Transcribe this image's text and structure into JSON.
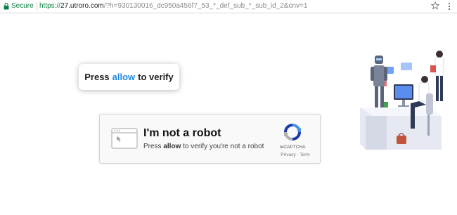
{
  "browser": {
    "secure_label": "Secure",
    "url_scheme": "https://",
    "url_host": "27.utroro.com",
    "url_rest": "/?h=930130016_dc950a456f7_53_*_def_sub_*_sub_id_2&cnv=1",
    "icons": {
      "lock": "lock-icon",
      "star": "star-icon",
      "menu": "kebab-menu-icon"
    }
  },
  "tooltip": {
    "before": "Press",
    "highlight": "allow",
    "after": "to verify",
    "highlight_color": "#1e88e5"
  },
  "captcha": {
    "title": "I'm not a robot",
    "sub_before": "Press",
    "sub_bold": "allow",
    "sub_after": "to verify you're not a robot",
    "brand": "reCAPTCHA",
    "links": "Privacy - Term",
    "icon": "browser-window-icon"
  },
  "colors": {
    "secure_green": "#0b8043",
    "accent_blue": "#1e88e5",
    "recaptcha_blue": "#1c3aa9",
    "recaptcha_light_blue": "#4a90e2",
    "recaptcha_gray": "#b0b0b0"
  }
}
